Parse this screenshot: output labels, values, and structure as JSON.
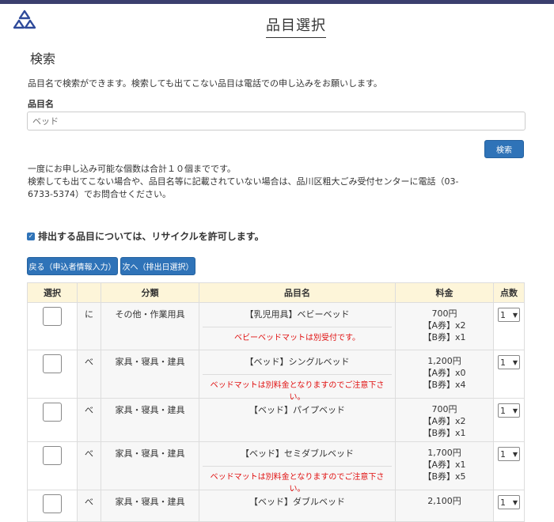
{
  "header": {
    "title": "品目選択"
  },
  "search": {
    "heading": "検索",
    "description": "品目名で検索ができます。検索しても出てこない品目は電話での申し込みをお願いします。",
    "field_label": "品目名",
    "placeholder": "ベッド",
    "button_label": "検索"
  },
  "notice": {
    "line1": "一度にお申し込み可能な個数は合計１０個までです。",
    "line2": "検索しても出てこない場合や、品目名等に記載されていない場合は、品川区粗大ごみ受付センターに電話（03-",
    "line3": "6733-5374）でお問合せください。"
  },
  "recycle": {
    "label": "排出する品目については、リサイクルを許可します。",
    "checked": true
  },
  "nav": {
    "back_label": "戻る（申込者情報入力）",
    "next_label": "次へ（排出日選択）"
  },
  "table": {
    "headers": {
      "select": "選択",
      "category": "分類",
      "name": "品目名",
      "price": "料金",
      "qty": "点数"
    },
    "rows": [
      {
        "kana": "に",
        "category": "その他・作業用具",
        "name": "【乳児用具】ベビーベッド",
        "note": "ベビーベッドマットは別受付です。",
        "price": "700円",
        "ticket_a": "【A券】x2",
        "ticket_b": "【B券】x1",
        "qty": "1"
      },
      {
        "kana": "べ",
        "category": "家具・寝具・建具",
        "name": "【ベッド】シングルベッド",
        "note": "ベッドマットは別料金となりますのでご注意下さい。",
        "price": "1,200円",
        "ticket_a": "【A券】x0",
        "ticket_b": "【B券】x4",
        "qty": "1"
      },
      {
        "kana": "べ",
        "category": "家具・寝具・建具",
        "name": "【ベッド】パイプベッド",
        "note": "",
        "price": "700円",
        "ticket_a": "【A券】x2",
        "ticket_b": "【B券】x1",
        "qty": "1"
      },
      {
        "kana": "べ",
        "category": "家具・寝具・建具",
        "name": "【ベッド】セミダブルベッド",
        "note": "ベッドマットは別料金となりますのでご注意下さい。",
        "price": "1,700円",
        "ticket_a": "【A券】x1",
        "ticket_b": "【B券】x5",
        "qty": "1"
      },
      {
        "kana": "べ",
        "category": "家具・寝具・建具",
        "name": "【ベッド】ダブルベッド",
        "note": "",
        "price": "2,100円",
        "ticket_a": "",
        "ticket_b": "",
        "qty": "1"
      }
    ]
  },
  "colors": {
    "accent": "#2f73b8",
    "topbar": "#3b3f6e",
    "header_bg": "#fdf5d9",
    "note_red": "#e01010"
  }
}
